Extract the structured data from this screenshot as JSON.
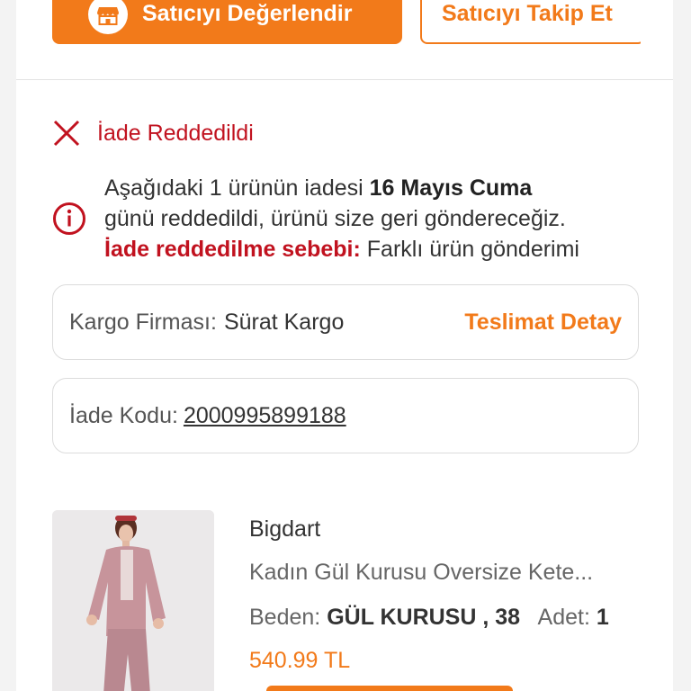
{
  "actions": {
    "rate_seller_label": "Satıcıyı Değerlendir",
    "follow_seller_label": "Satıcıyı Takip Et"
  },
  "return_status": {
    "title": "İade Reddedildi",
    "line1_prefix": "Aşağıdaki 1 ürünün iadesi ",
    "line1_date": "16 Mayıs Cuma",
    "line2": "günü reddedildi, ürünü size geri göndereceğiz.",
    "reason_label": "İade reddedilme sebebi:",
    "reason_value": " Farklı ürün gönderimi"
  },
  "shipping": {
    "label": "Kargo Firması:",
    "value": "Sürat Kargo",
    "detail_link": "Teslimat Detay"
  },
  "return_code": {
    "label": "İade Kodu:",
    "value": "2000995899188"
  },
  "product": {
    "brand": "Bigdart",
    "title": "Kadın Gül Kurusu Oversize Kete...",
    "size_label": "Beden:",
    "size_value": "GÜL KURUSU , 38",
    "qty_label": "Adet:",
    "qty_value": "1",
    "price": "540.99 TL"
  },
  "colors": {
    "accent": "#f27a1a",
    "error": "#c1121f"
  }
}
